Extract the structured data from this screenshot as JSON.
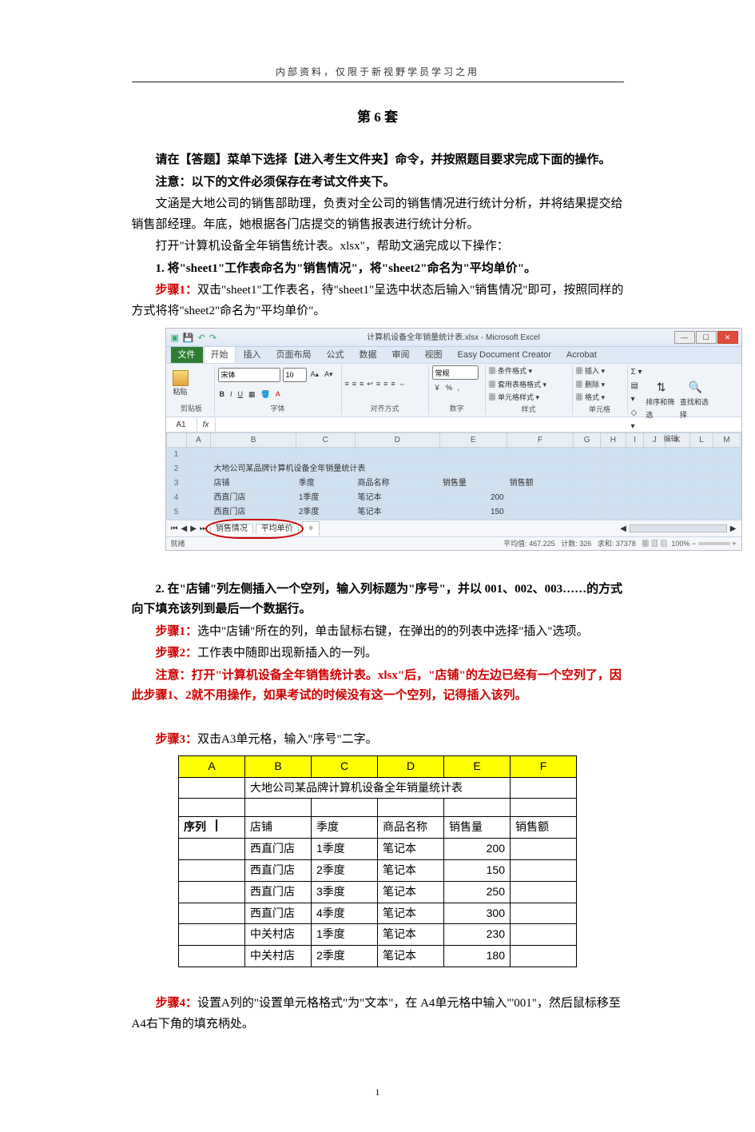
{
  "header": "内部资料，仅限于新视野学员学习之用",
  "title": "第 6 套",
  "intro": {
    "p1": "请在【答题】菜单下选择【进入考生文件夹】命令，并按照题目要求完成下面的操作。",
    "p2": "注意：以下的文件必须保存在考试文件夹下。",
    "p3": "文涵是大地公司的销售部助理，负责对全公司的销售情况进行统计分析，并将结果提交给销售部经理。年底，她根据各门店提交的销售报表进行统计分析。",
    "p4": "打开\"计算机设备全年销售统计表。xlsx\"，帮助文涵完成以下操作："
  },
  "q1": {
    "title": "1. 将\"sheet1\"工作表命名为\"销售情况\"，将\"sheet2\"命名为\"平均单价\"。",
    "step1_label": "步骤1：",
    "step1_text": "双击\"sheet1\"工作表名，待\"sheet1\"呈选中状态后输入\"销售情况\"即可，按照同样的方式将将\"sheet2\"命名为\"平均单价\"。"
  },
  "excel1": {
    "filetitle": "计算机设备全年销量统计表.xlsx - Microsoft Excel",
    "tabs": {
      "file": "文件",
      "home": "开始",
      "insert": "插入",
      "layout": "页面布局",
      "formula": "公式",
      "data": "数据",
      "review": "审阅",
      "view": "视图",
      "edc": "Easy Document Creator",
      "acrobat": "Acrobat"
    },
    "ribbon": {
      "paste": "粘贴",
      "clipboard": "剪贴板",
      "font": "字体",
      "fontname": "宋体",
      "fontsize": "10",
      "align": "对齐方式",
      "number": "数字",
      "number_fmt": "常规",
      "styles": "样式",
      "cond": "条件格式",
      "fmttbl": "套用表格格式",
      "cellstyle": "单元格样式",
      "cells": "单元格",
      "insert": "插入",
      "delete": "删除",
      "format": "格式",
      "editing": "编辑",
      "sort": "排序和筛选",
      "find": "查找和选择"
    },
    "namebox": "A1",
    "fx": "fx",
    "cols": [
      "",
      "A",
      "B",
      "C",
      "D",
      "E",
      "F",
      "G",
      "H",
      "I",
      "J",
      "K",
      "L",
      "M"
    ],
    "row2_b": "大地公司某品牌计算机设备全年销量统计表",
    "row3": {
      "b": "店铺",
      "c": "季度",
      "d": "商品名称",
      "e": "销售量",
      "f": "销售额"
    },
    "row4": {
      "b": "西直门店",
      "c": "1季度",
      "d": "笔记本",
      "e": "200"
    },
    "row5": {
      "b": "西直门店",
      "c": "2季度",
      "d": "笔记本",
      "e": "150"
    },
    "tabs2": {
      "t1": "销售情况",
      "t2": "平均单价"
    },
    "status_ready": "就绪",
    "status_avg": "平均值: 467.225",
    "status_cnt": "计数: 326",
    "status_sum": "求和: 37378",
    "zoom": "100%"
  },
  "q2": {
    "title": "2. 在\"店铺\"列左侧插入一个空列，输入列标题为\"序号\"，并以 001、002、003……的方式向下填充该列到最后一个数据行。",
    "step1_label": "步骤1：",
    "step1_text": "选中\"店铺\"所在的列，单击鼠标右键，在弹出的的列表中选择\"插入\"选项。",
    "step2_label": "步骤2：",
    "step2_text": "工作表中随即出现新插入的一列。",
    "note_label": "注意：",
    "note_text": "打开\"计算机设备全年销售统计表。xlsx\"后，\"店铺\"的左边已经有一个空列了，因此步骤1、2就不用操作，如果考试的时候没有这一个空列，记得插入该列。",
    "step3_label": "步骤3：",
    "step3_text": "双击A3单元格，输入\"序号\"二字。"
  },
  "chart_data": {
    "type": "table",
    "title": "大地公司某品牌计算机设备全年销量统计表",
    "columns": [
      "A",
      "B",
      "C",
      "D",
      "E",
      "F"
    ],
    "header_row": [
      "序列",
      "店铺",
      "季度",
      "商品名称",
      "销售量",
      "销售额"
    ],
    "rows": [
      [
        "",
        "西直门店",
        "1季度",
        "笔记本",
        200,
        ""
      ],
      [
        "",
        "西直门店",
        "2季度",
        "笔记本",
        150,
        ""
      ],
      [
        "",
        "西直门店",
        "3季度",
        "笔记本",
        250,
        ""
      ],
      [
        "",
        "西直门店",
        "4季度",
        "笔记本",
        300,
        ""
      ],
      [
        "",
        "中关村店",
        "1季度",
        "笔记本",
        230,
        ""
      ],
      [
        "",
        "中关村店",
        "2季度",
        "笔记本",
        180,
        ""
      ]
    ]
  },
  "q2_step4": {
    "label": "步骤4：",
    "text": "设置A列的\"设置单元格格式\"为\"文本\"，在 A4单元格中输入\"'001\"，然后鼠标移至A4右下角的填充柄处。"
  },
  "page_number": "1"
}
